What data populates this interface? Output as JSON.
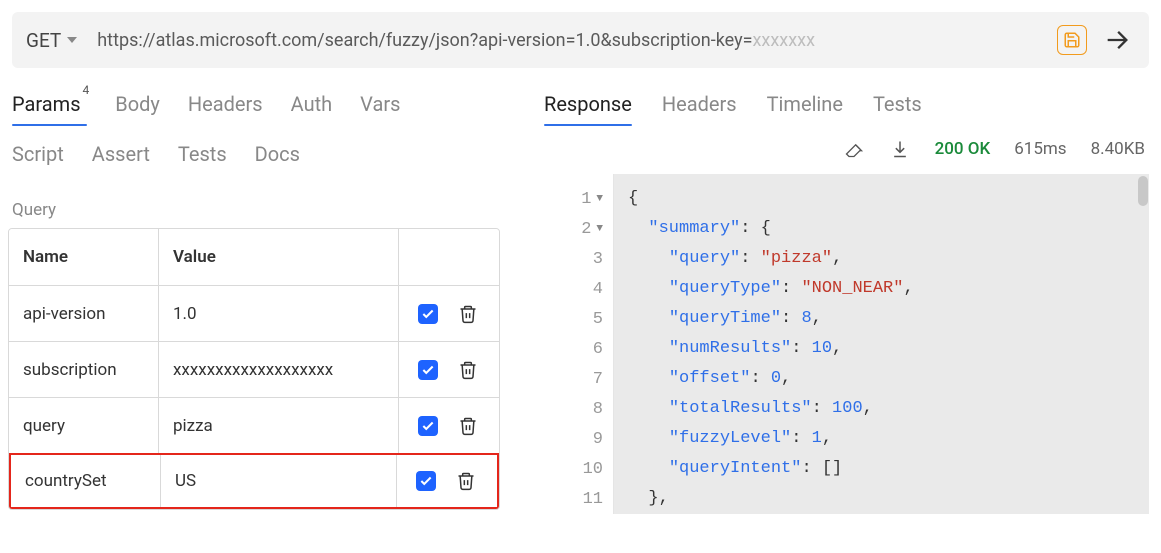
{
  "request": {
    "method": "GET",
    "url_prefix": "https://atlas.microsoft.com/search/fuzzy/json?api-version=1.0&subscription-key=",
    "url_masked_suffix": "xxxxxxx"
  },
  "left_tabs": {
    "row1": [
      {
        "label": "Params",
        "badge": "4",
        "active": true
      },
      {
        "label": "Body"
      },
      {
        "label": "Headers"
      },
      {
        "label": "Auth"
      },
      {
        "label": "Vars"
      }
    ],
    "row2": [
      {
        "label": "Script"
      },
      {
        "label": "Assert"
      },
      {
        "label": "Tests"
      },
      {
        "label": "Docs"
      }
    ]
  },
  "query": {
    "section_label": "Query",
    "headers": {
      "name": "Name",
      "value": "Value"
    },
    "params": [
      {
        "name": "api-version",
        "value": "1.0",
        "enabled": true,
        "highlight": false
      },
      {
        "name": "subscription",
        "value": "xxxxxxxxxxxxxxxxxxx",
        "enabled": true,
        "highlight": false
      },
      {
        "name": "query",
        "value": "pizza",
        "enabled": true,
        "highlight": false
      },
      {
        "name": "countrySet",
        "value": "US",
        "enabled": true,
        "highlight": true
      }
    ]
  },
  "response": {
    "tabs": [
      {
        "label": "Response",
        "active": true
      },
      {
        "label": "Headers"
      },
      {
        "label": "Timeline"
      },
      {
        "label": "Tests"
      }
    ],
    "status": "200 OK",
    "time": "615ms",
    "size": "8.40KB",
    "json": {
      "summary": {
        "query": "pizza",
        "queryType": "NON_NEAR",
        "queryTime": 8,
        "numResults": 10,
        "offset": 0,
        "totalResults": 100,
        "fuzzyLevel": 1,
        "queryIntent": []
      }
    }
  },
  "icons": {
    "save": "save-icon",
    "send": "arrow-right-icon",
    "clear": "eraser-icon",
    "download": "download-icon",
    "check": "check-icon",
    "trash": "trash-icon",
    "chevron": "chevron-down-icon",
    "fold": "fold-triangle-icon"
  }
}
